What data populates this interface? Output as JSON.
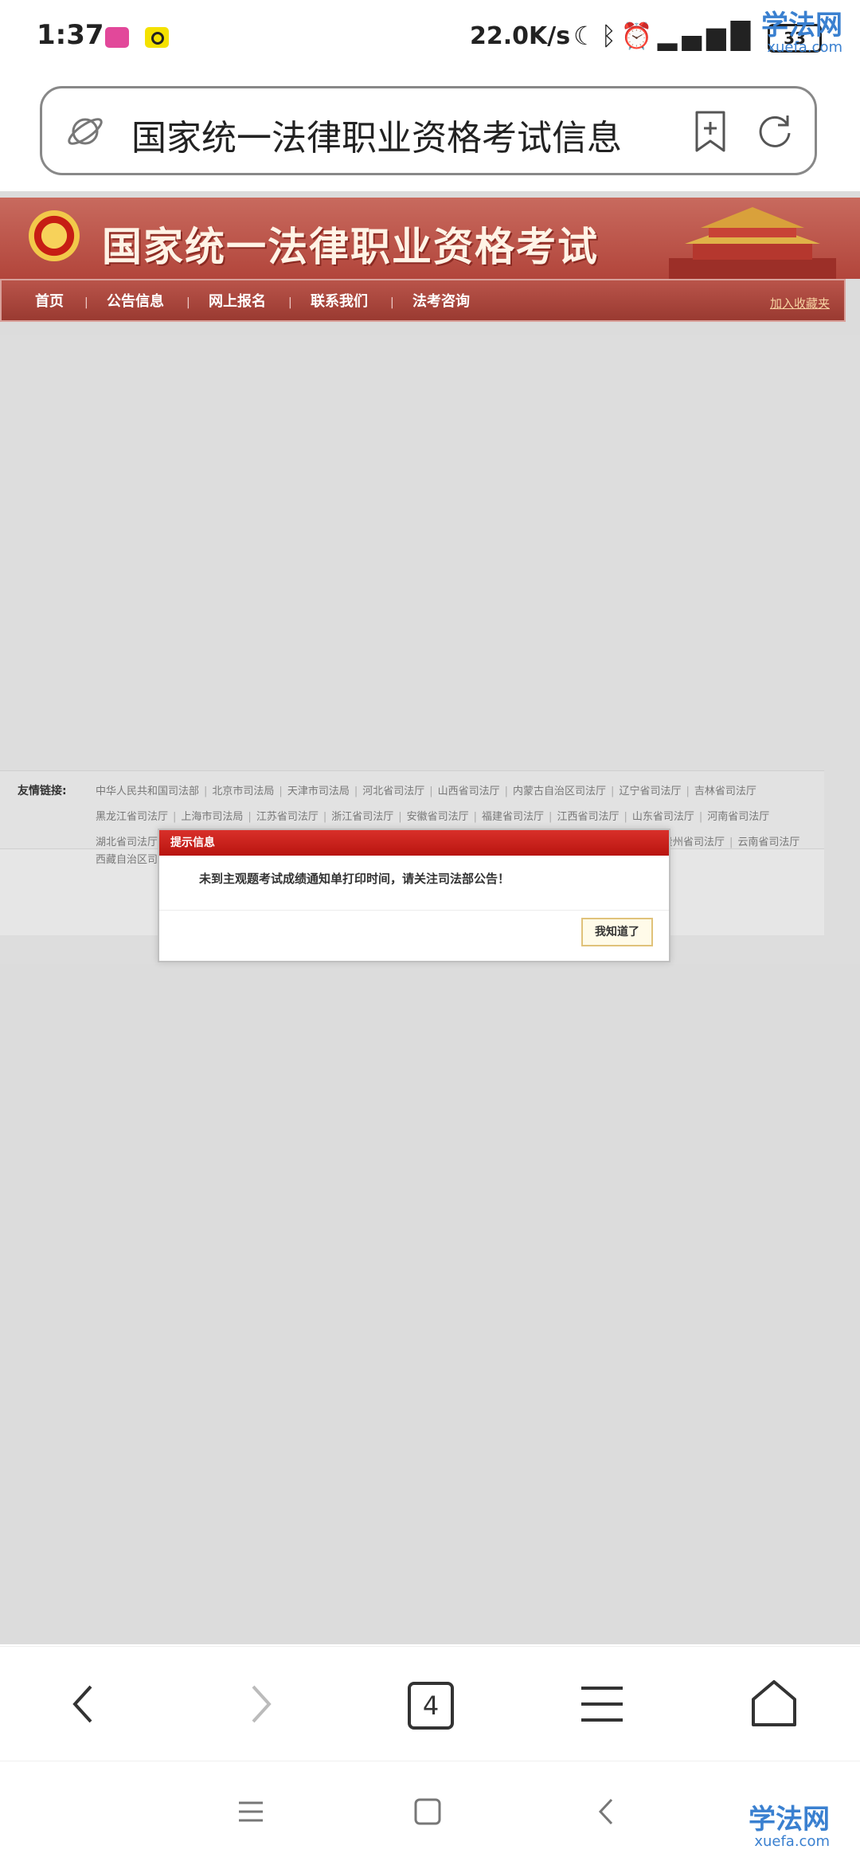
{
  "status_bar": {
    "time": "1:37",
    "net_speed": "22.0K/s",
    "battery": "33",
    "icons": [
      "moon-icon",
      "bluetooth-icon",
      "alarm-icon",
      "signal-icon",
      "wifi-icon"
    ]
  },
  "watermark": {
    "text": "学法网",
    "domain": "xuefa.com"
  },
  "browser": {
    "url_text": "国家统一法律职业资格考试信息",
    "tab_count": "4"
  },
  "site": {
    "title": "国家统一法律职业资格考试",
    "nav": [
      "首页",
      "公告信息",
      "网上报名",
      "联系我们",
      "法考咨询"
    ],
    "nav_sep": "|",
    "add_favorite": "加入收藏夹",
    "links_label": "友情链接:",
    "links_rows": [
      [
        "中华人民共和国司法部",
        "北京市司法局",
        "天津市司法局",
        "河北省司法厅",
        "山西省司法厅",
        "内蒙古自治区司法厅",
        "辽宁省司法厅",
        "吉林省司法厅"
      ],
      [
        "黑龙江省司法厅",
        "上海市司法局",
        "江苏省司法厅",
        "浙江省司法厅",
        "安徽省司法厅",
        "福建省司法厅",
        "江西省司法厅",
        "山东省司法厅",
        "河南省司法厅"
      ],
      [
        "湖北省司法厅",
        "贵州省司法厅",
        "云南省司法厅"
      ],
      [
        "西藏自治区司"
      ]
    ]
  },
  "dialog": {
    "title": "提示信息",
    "message": "未到主观题考试成绩通知单打印时间，请关注司法部公告！",
    "ok_label": "我知道了"
  }
}
